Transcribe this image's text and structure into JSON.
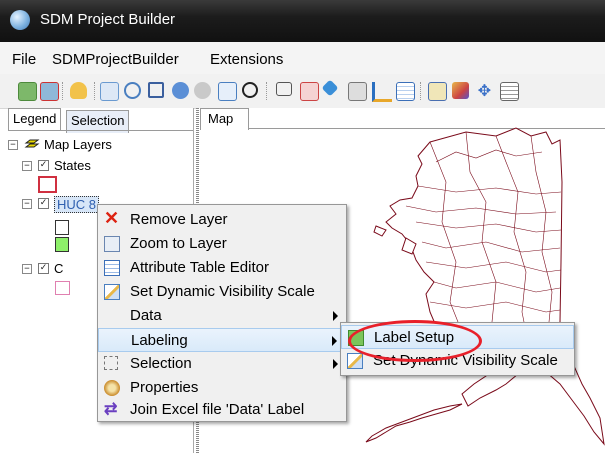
{
  "window": {
    "title": "SDM Project Builder"
  },
  "menubar": [
    "File",
    "SDMProjectBuilder",
    "Extensions"
  ],
  "tabs": {
    "legend": "Legend",
    "selection": "Selection",
    "map": "Map"
  },
  "tree": {
    "root": "Map Layers",
    "states": "States",
    "huc_label": "HUC 8",
    "third_label": "C"
  },
  "context_menu": {
    "items": [
      {
        "label": "Remove Layer",
        "icon": "remove-x-icon"
      },
      {
        "label": "Zoom to Layer",
        "icon": "zoom-layer-icon"
      },
      {
        "label": "Attribute Table Editor",
        "icon": "table-icon"
      },
      {
        "label": "Set Dynamic Visibility Scale",
        "icon": "visibility-scale-icon"
      },
      {
        "label": "Data",
        "submenu": true
      },
      {
        "label": "Labeling",
        "submenu": true,
        "highlighted": true
      },
      {
        "label": "Selection",
        "icon": "selection-arrow-icon",
        "submenu": true
      },
      {
        "label": "Properties",
        "icon": "properties-icon"
      },
      {
        "label": "Join Excel file 'Data' Label",
        "icon": "join-arrows-icon"
      }
    ]
  },
  "submenu": {
    "items": [
      {
        "label": "Label Setup",
        "icon": "label-setup-icon",
        "highlighted": true
      },
      {
        "label": "Set Dynamic Visibility Scale",
        "icon": "visibility-scale-icon"
      }
    ]
  },
  "colors": {
    "highlight": "#d9eafa",
    "annotation_circle": "#e8202a",
    "map_outline": "#7a0a1a",
    "map_fill": "#ffffff"
  }
}
